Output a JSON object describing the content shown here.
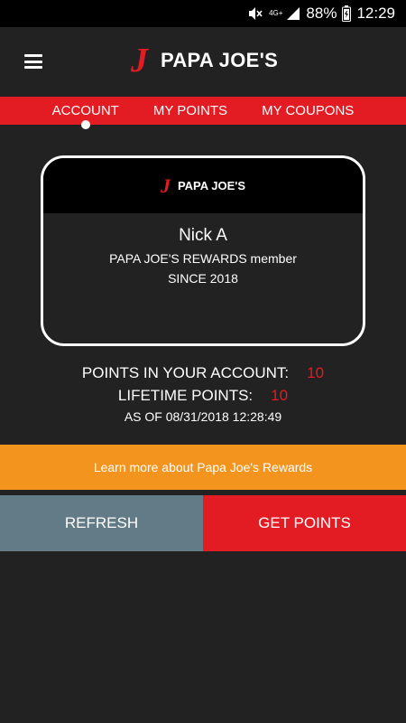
{
  "status_bar": {
    "network_label": "4G+",
    "battery_percent": "88%",
    "time": "12:29",
    "icons": [
      "mute-icon",
      "signal-icon",
      "battery-icon"
    ]
  },
  "header": {
    "logo_letter": "J",
    "brand": "PAPA JOE'S",
    "menu_icon": "hamburger-menu-icon"
  },
  "tabs": [
    {
      "label": "ACCOUNT",
      "active": true
    },
    {
      "label": "MY POINTS",
      "active": false
    },
    {
      "label": "MY COUPONS",
      "active": false
    }
  ],
  "card": {
    "logo_letter": "J",
    "brand": "PAPA JOE'S",
    "name": "Nick A",
    "membership": "PAPA JOE'S REWARDS member",
    "since": "SINCE 2018"
  },
  "points": {
    "account_label": "POINTS IN YOUR ACCOUNT:",
    "account_value": "10",
    "lifetime_label": "LIFETIME POINTS:",
    "lifetime_value": "10",
    "as_of": "AS OF 08/31/2018 12:28:49"
  },
  "learn_more": "Learn more about Papa Joe's Rewards",
  "buttons": {
    "refresh": "REFRESH",
    "get_points": "GET POINTS"
  },
  "colors": {
    "brand_red": "#e31b23",
    "orange": "#f3941f",
    "slate": "#637a87",
    "background": "#222222"
  }
}
